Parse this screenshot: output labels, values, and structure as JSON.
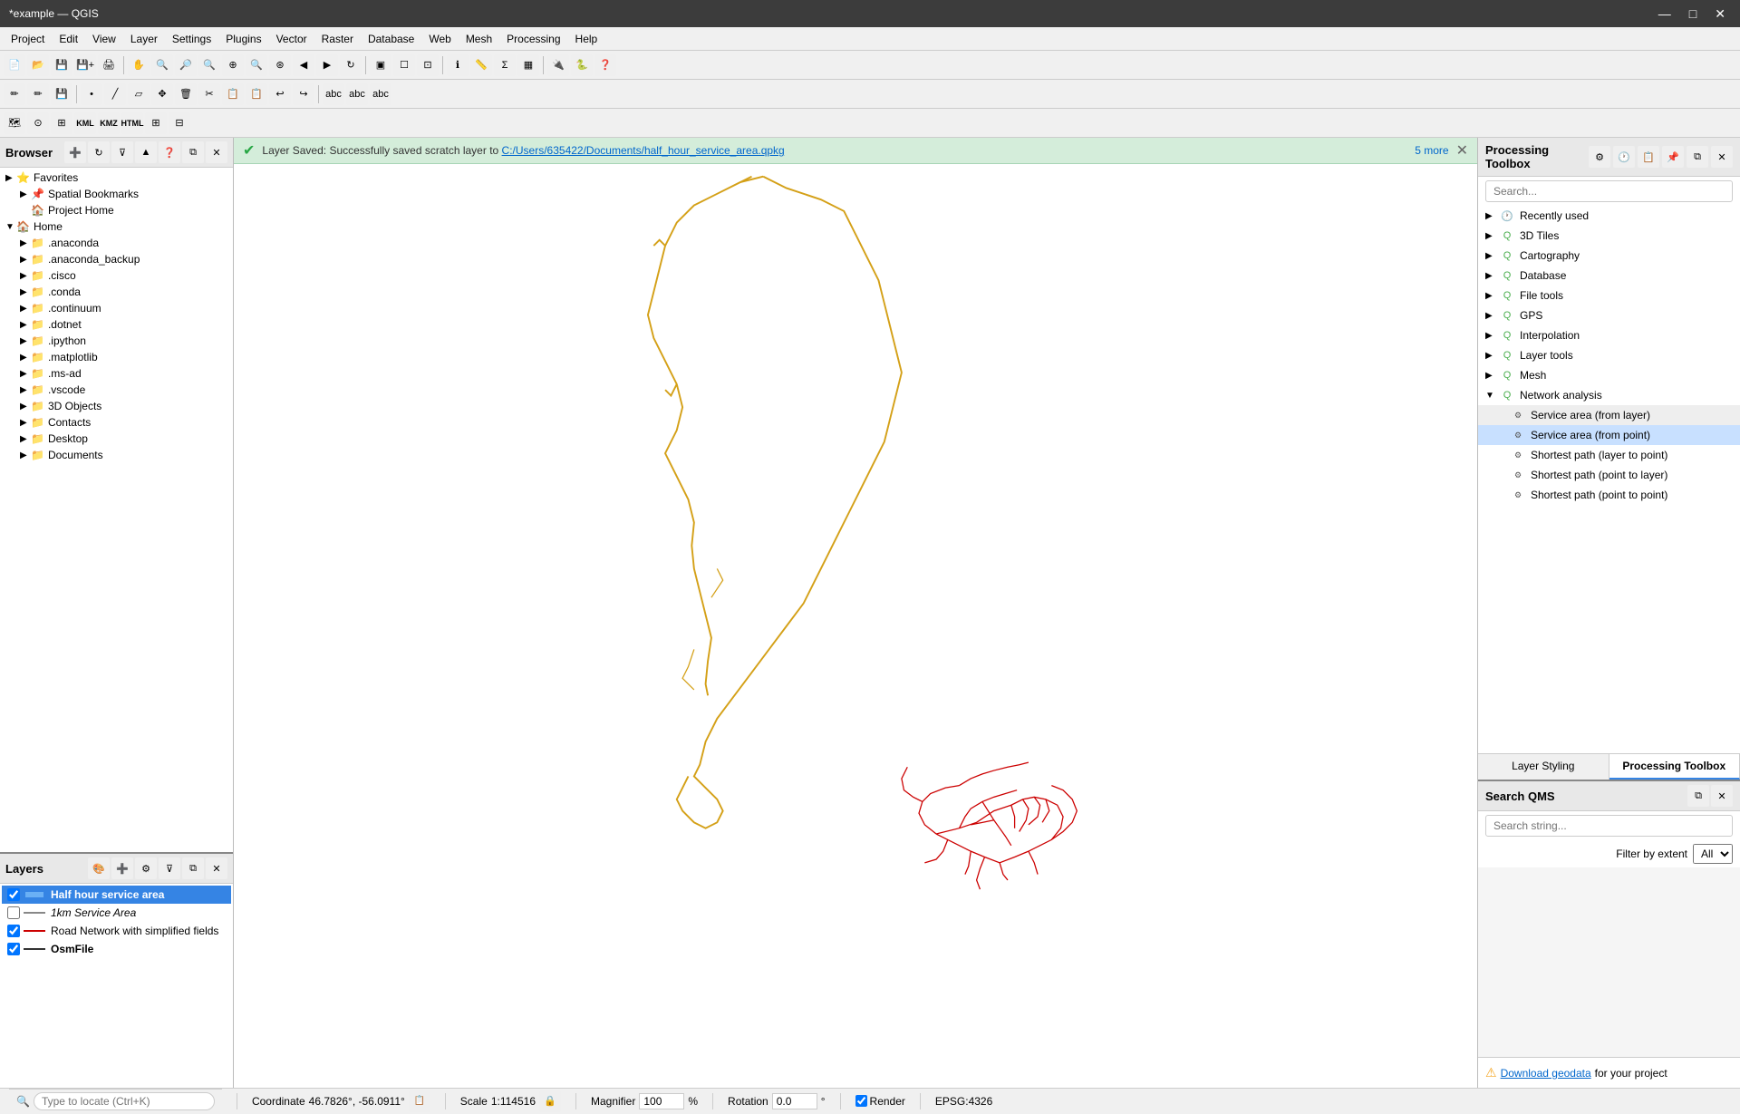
{
  "titlebar": {
    "title": "*example — QGIS",
    "minimize": "—",
    "maximize": "□",
    "close": "✕"
  },
  "menubar": {
    "items": [
      "Project",
      "Edit",
      "View",
      "Layer",
      "Settings",
      "Plugins",
      "Vector",
      "Raster",
      "Database",
      "Web",
      "Mesh",
      "Processing",
      "Help"
    ]
  },
  "browser": {
    "title": "Browser",
    "items": [
      {
        "id": "favorites",
        "label": "Favorites",
        "level": 0,
        "arrow": "▶",
        "icon": "⭐",
        "expanded": false
      },
      {
        "id": "spatial-bookmarks",
        "label": "Spatial Bookmarks",
        "level": 1,
        "arrow": "▶",
        "icon": "📌",
        "expanded": false
      },
      {
        "id": "project-home",
        "label": "Project Home",
        "level": 1,
        "arrow": "",
        "icon": "🏠",
        "expanded": false
      },
      {
        "id": "home",
        "label": "Home",
        "level": 0,
        "arrow": "▼",
        "icon": "🏠",
        "expanded": true
      },
      {
        "id": "anaconda",
        "label": ".anaconda",
        "level": 1,
        "arrow": "▶",
        "icon": "📁",
        "expanded": false
      },
      {
        "id": "anaconda-backup",
        "label": ".anaconda_backup",
        "level": 1,
        "arrow": "▶",
        "icon": "📁",
        "expanded": false
      },
      {
        "id": "cisco",
        "label": ".cisco",
        "level": 1,
        "arrow": "▶",
        "icon": "📁",
        "expanded": false
      },
      {
        "id": "conda",
        "label": ".conda",
        "level": 1,
        "arrow": "▶",
        "icon": "📁",
        "expanded": false
      },
      {
        "id": "continuum",
        "label": ".continuum",
        "level": 1,
        "arrow": "▶",
        "icon": "📁",
        "expanded": false
      },
      {
        "id": "dotnet",
        "label": ".dotnet",
        "level": 1,
        "arrow": "▶",
        "icon": "📁",
        "expanded": false
      },
      {
        "id": "ipython",
        "label": ".ipython",
        "level": 1,
        "arrow": "▶",
        "icon": "📁",
        "expanded": false
      },
      {
        "id": "matplotlib",
        "label": ".matplotlib",
        "level": 1,
        "arrow": "▶",
        "icon": "📁",
        "expanded": false
      },
      {
        "id": "ms-ad",
        "label": ".ms-ad",
        "level": 1,
        "arrow": "▶",
        "icon": "📁",
        "expanded": false
      },
      {
        "id": "vscode",
        "label": ".vscode",
        "level": 1,
        "arrow": "▶",
        "icon": "📁",
        "expanded": false
      },
      {
        "id": "3dobjects",
        "label": "3D Objects",
        "level": 1,
        "arrow": "▶",
        "icon": "📁",
        "expanded": false
      },
      {
        "id": "contacts",
        "label": "Contacts",
        "level": 1,
        "arrow": "▶",
        "icon": "📁",
        "expanded": false
      },
      {
        "id": "desktop",
        "label": "Desktop",
        "level": 1,
        "arrow": "▶",
        "icon": "📁",
        "expanded": false
      },
      {
        "id": "documents",
        "label": "Documents",
        "level": 1,
        "arrow": "▶",
        "icon": "📁",
        "expanded": false
      }
    ]
  },
  "layers": {
    "title": "Layers",
    "items": [
      {
        "id": "half-hour",
        "label": "Half hour service area",
        "checked": true,
        "color": "#3584e4",
        "linecolor": "#3584e4",
        "bold": true,
        "active": true
      },
      {
        "id": "1km",
        "label": "1km Service Area",
        "checked": false,
        "color": "#888",
        "linecolor": "#888",
        "italic": true,
        "active": false
      },
      {
        "id": "road-network",
        "label": "Road Network with simplified fields",
        "checked": true,
        "color": "#c00",
        "linecolor": "#c00",
        "bold": false,
        "active": false
      },
      {
        "id": "osmfile",
        "label": "OsmFile",
        "checked": true,
        "color": "#333",
        "linecolor": "#333",
        "bold": false,
        "active": false
      }
    ]
  },
  "notification": {
    "message": "Layer Saved: Successfully saved scratch layer to",
    "link_text": "C:/Users/635422/Documents/half_hour_service_area.qpkg",
    "more": "5 more"
  },
  "processing_toolbox": {
    "title": "Processing Toolbox",
    "search_placeholder": "Search...",
    "items": [
      {
        "id": "recently-used",
        "label": "Recently used",
        "arrow": "▶",
        "expanded": false,
        "level": 0
      },
      {
        "id": "3d-tiles",
        "label": "3D Tiles",
        "arrow": "▶",
        "expanded": false,
        "level": 0
      },
      {
        "id": "cartography",
        "label": "Cartography",
        "arrow": "▶",
        "expanded": false,
        "level": 0
      },
      {
        "id": "database",
        "label": "Database",
        "arrow": "▶",
        "expanded": false,
        "level": 0
      },
      {
        "id": "file-tools",
        "label": "File tools",
        "arrow": "▶",
        "expanded": false,
        "level": 0
      },
      {
        "id": "gps",
        "label": "GPS",
        "arrow": "▶",
        "expanded": false,
        "level": 0
      },
      {
        "id": "interpolation",
        "label": "Interpolation",
        "arrow": "▶",
        "expanded": false,
        "level": 0
      },
      {
        "id": "layer-tools",
        "label": "Layer tools",
        "arrow": "▶",
        "expanded": false,
        "level": 0
      },
      {
        "id": "mesh",
        "label": "Mesh",
        "arrow": "▶",
        "expanded": false,
        "level": 0
      },
      {
        "id": "network-analysis",
        "label": "Network analysis",
        "arrow": "▼",
        "expanded": true,
        "level": 0
      }
    ],
    "network_items": [
      {
        "id": "service-area-from-layer",
        "label": "Service area (from layer)"
      },
      {
        "id": "service-area-from-point",
        "label": "Service area (from point)"
      },
      {
        "id": "shortest-path-layer-to-point",
        "label": "Shortest path (layer to point)"
      },
      {
        "id": "shortest-path-point-to-layer",
        "label": "Shortest path (point to layer)"
      },
      {
        "id": "shortest-path-point-to-point",
        "label": "Shortest path (point to point)"
      }
    ],
    "tabs": [
      {
        "id": "layer-styling",
        "label": "Layer Styling"
      },
      {
        "id": "processing-toolbox-tab",
        "label": "Processing Toolbox"
      }
    ],
    "active_tab": "processing-toolbox-tab"
  },
  "qms": {
    "title": "Search QMS",
    "search_placeholder": "Search string...",
    "filter_label": "Filter by extent",
    "filter_options": [
      "All"
    ],
    "footer_text": "Download geodata",
    "footer_suffix": " for your project"
  },
  "statusbar": {
    "coordinate_label": "Coordinate",
    "coordinate_value": "46.7826°, -56.0911°",
    "scale_label": "Scale",
    "scale_value": "1:114516",
    "magnifier_label": "Magnifier",
    "magnifier_value": "100%",
    "rotation_label": "Rotation",
    "rotation_value": "0.0 °",
    "render_label": "Render",
    "epsg_label": "EPSG:4326"
  },
  "locate": {
    "placeholder": "Type to locate (Ctrl+K)"
  }
}
